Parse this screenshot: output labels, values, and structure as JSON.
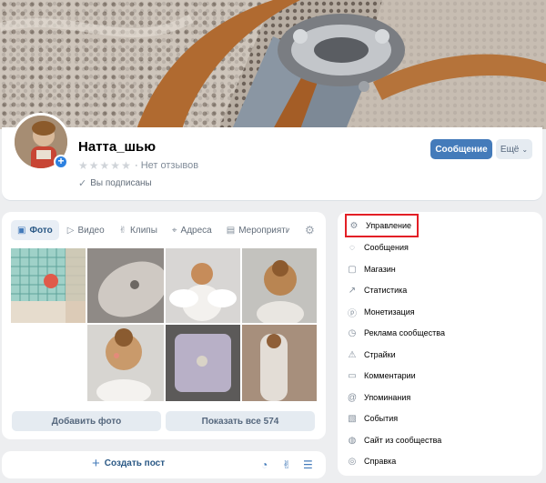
{
  "profile": {
    "name": "Натта_шью",
    "reviews": "· Нет отзывов",
    "subscribed": "Вы подписаны",
    "message_button": "Сообщение",
    "more_button": "Ещё"
  },
  "media": {
    "tabs": [
      {
        "label": "Фото",
        "icon": "photo-icon"
      },
      {
        "label": "Видео",
        "icon": "video-icon"
      },
      {
        "label": "Клипы",
        "icon": "clips-icon"
      },
      {
        "label": "Адреса",
        "icon": "location-icon"
      },
      {
        "label": "Мероприятия",
        "icon": "calendar-icon"
      }
    ],
    "add_photo": "Добавить фото",
    "show_all": "Показать все 574"
  },
  "post": {
    "create": "Создать пост"
  },
  "menu": {
    "items": [
      {
        "label": "Управление",
        "icon": "gear-icon"
      },
      {
        "label": "Сообщения",
        "icon": "message-icon"
      },
      {
        "label": "Магазин",
        "icon": "shop-icon"
      },
      {
        "label": "Статистика",
        "icon": "stats-icon"
      },
      {
        "label": "Монетизация",
        "icon": "money-icon"
      },
      {
        "label": "Реклама сообщества",
        "icon": "ads-icon"
      },
      {
        "label": "Страйки",
        "icon": "warning-icon"
      },
      {
        "label": "Комментарии",
        "icon": "comment-icon"
      },
      {
        "label": "Упоминания",
        "icon": "mention-icon"
      },
      {
        "label": "События",
        "icon": "events-icon"
      },
      {
        "label": "Сайт из сообщества",
        "icon": "globe-icon"
      },
      {
        "label": "Справка",
        "icon": "help-icon"
      }
    ]
  },
  "colors": {
    "accent": "#447bba",
    "highlight_box": "#e31f26",
    "background": "#edeef0"
  }
}
